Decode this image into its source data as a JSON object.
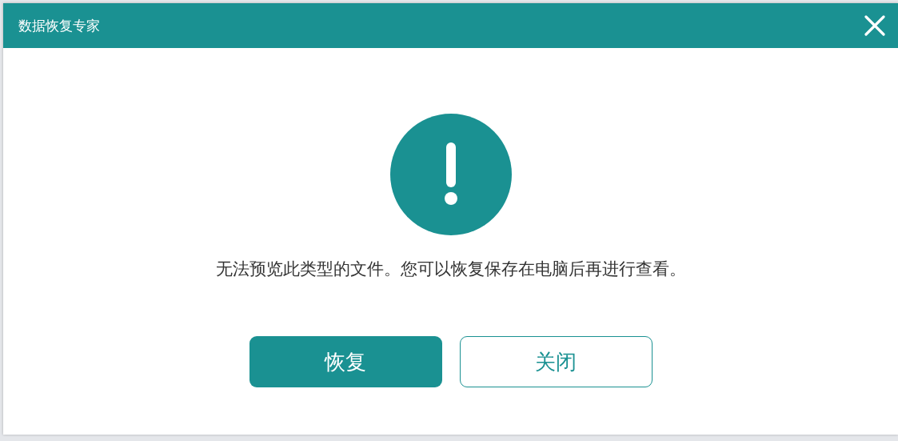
{
  "dialog": {
    "title": "数据恢复专家",
    "message": "无法预览此类型的文件。您可以恢复保存在电脑后再进行查看。",
    "buttons": [
      {
        "label": "恢复",
        "kind": "primary"
      },
      {
        "label": "关闭",
        "kind": "secondary"
      }
    ]
  }
}
